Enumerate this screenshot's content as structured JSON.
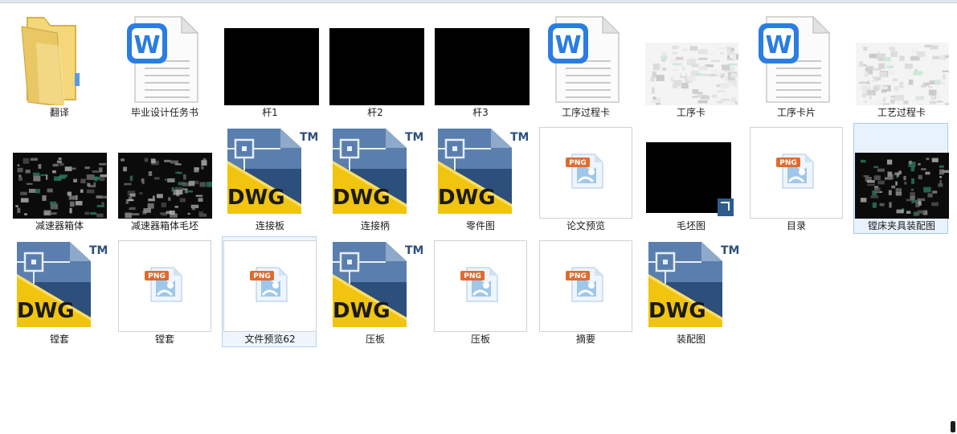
{
  "items": [
    {
      "label": "翻译",
      "kind": "folder"
    },
    {
      "label": "毕业设计任务书",
      "kind": "word"
    },
    {
      "label": "杆1",
      "kind": "black"
    },
    {
      "label": "杆2",
      "kind": "black"
    },
    {
      "label": "杆3",
      "kind": "black"
    },
    {
      "label": "工序过程卡",
      "kind": "word"
    },
    {
      "label": "工序卡",
      "kind": "table-preview"
    },
    {
      "label": "工序卡片",
      "kind": "word"
    },
    {
      "label": "工艺过程卡",
      "kind": "table-preview"
    },
    {
      "label": "减速器箱体",
      "kind": "cad-dark"
    },
    {
      "label": "减速器箱体毛坯",
      "kind": "cad-dark"
    },
    {
      "label": "连接板",
      "kind": "dwg"
    },
    {
      "label": "连接柄",
      "kind": "dwg"
    },
    {
      "label": "零件图",
      "kind": "dwg"
    },
    {
      "label": "论文预览",
      "kind": "png"
    },
    {
      "label": "毛坯图",
      "kind": "black-shortcut"
    },
    {
      "label": "目录",
      "kind": "png"
    },
    {
      "label": "镗床夹具装配图",
      "kind": "cad-dark",
      "state": "hover"
    },
    {
      "label": "镗套",
      "kind": "dwg"
    },
    {
      "label": "镗套",
      "kind": "png"
    },
    {
      "label": "文件预览62",
      "kind": "png",
      "state": "selected"
    },
    {
      "label": "压板",
      "kind": "dwg"
    },
    {
      "label": "压板",
      "kind": "png"
    },
    {
      "label": "摘要",
      "kind": "png"
    },
    {
      "label": "装配图",
      "kind": "dwg"
    }
  ],
  "icons": {
    "dwg_text": "DWG",
    "tm_text": "TM",
    "png_text": "PNG",
    "word_letter": "W"
  },
  "colors": {
    "dwg_yellow": "#f1c40f",
    "dwg_blue": "#2d4f7c",
    "word_blue": "#2a7de1",
    "png_orange": "#e06b2e"
  }
}
